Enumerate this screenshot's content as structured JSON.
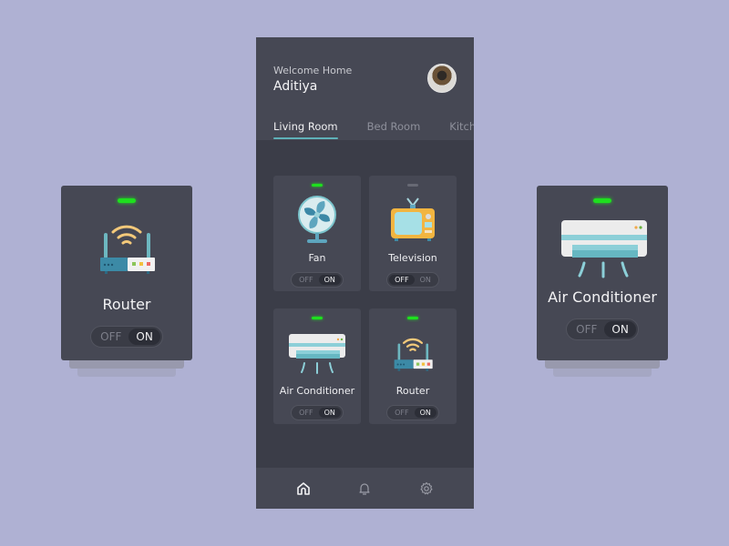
{
  "header": {
    "welcome": "Welcome Home",
    "username": "Aditiya"
  },
  "tabs": [
    {
      "label": "Living Room",
      "active": true
    },
    {
      "label": "Bed Room",
      "active": false
    },
    {
      "label": "Kitchen",
      "active": false
    }
  ],
  "devices": [
    {
      "name": "Fan",
      "icon": "fan-icon",
      "status": "on",
      "toggle_off": "OFF",
      "toggle_on": "ON"
    },
    {
      "name": "Television",
      "icon": "television-icon",
      "status": "off",
      "toggle_off": "OFF",
      "toggle_on": "ON"
    },
    {
      "name": "Air Conditioner",
      "icon": "air-conditioner-icon",
      "status": "on",
      "toggle_off": "OFF",
      "toggle_on": "ON"
    },
    {
      "name": "Router",
      "icon": "router-icon",
      "status": "on",
      "toggle_off": "OFF",
      "toggle_on": "ON"
    }
  ],
  "side_cards": {
    "left": {
      "name": "Router",
      "status": "on",
      "toggle_off": "OFF",
      "toggle_on": "ON"
    },
    "right": {
      "name": "Air Conditioner",
      "status": "on",
      "toggle_off": "OFF",
      "toggle_on": "ON"
    }
  },
  "bottom_nav": [
    {
      "icon": "home-icon",
      "active": true
    },
    {
      "icon": "bell-icon",
      "active": false
    },
    {
      "icon": "gear-icon",
      "active": false
    }
  ],
  "colors": {
    "background": "#afb1d3",
    "card": "#464854",
    "led_on": "#1ee01e",
    "accent": "#5fb1b8"
  }
}
